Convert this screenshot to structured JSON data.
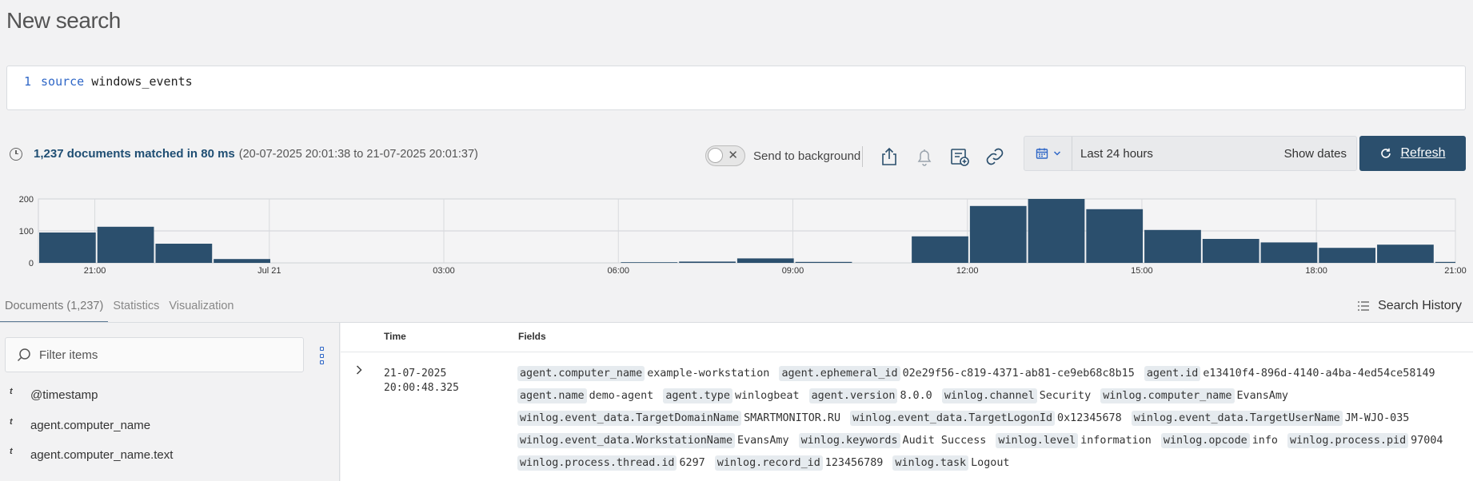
{
  "page": {
    "title": "New search"
  },
  "query": {
    "line_number": "1",
    "keyword": "source",
    "text": "windows_events"
  },
  "summary": {
    "count_text": "1,237 documents matched in 80 ms",
    "range_text": "(20-07-2025 20:01:38 to 21-07-2025 20:01:37)"
  },
  "toolbar": {
    "send_to_background": "Send to background",
    "send_to_background_enabled": false,
    "icons": [
      "share-icon",
      "bell-icon",
      "add-report-icon",
      "link-icon"
    ]
  },
  "date_picker": {
    "preset": "Last 24 hours",
    "show_dates": "Show dates"
  },
  "refresh": {
    "label": "Refresh",
    "accent": "#2b4f6d"
  },
  "chart_data": {
    "type": "bar",
    "y_ticks": [
      "200",
      "100",
      "0"
    ],
    "ylim": [
      0,
      200
    ],
    "x_ticks": [
      "21:00",
      "Jul 21",
      "03:00",
      "06:00",
      "09:00",
      "12:00",
      "15:00",
      "18:00",
      "21:00"
    ],
    "bar_color": "#2b4f6d",
    "grid": true,
    "values": [
      95,
      113,
      60,
      12,
      0,
      0,
      0,
      0,
      0,
      0,
      2,
      4,
      14,
      3,
      0,
      83,
      178,
      200,
      168,
      103,
      75,
      64,
      47,
      57,
      3
    ]
  },
  "tabs": [
    {
      "label": "Documents (1,237)",
      "active": true
    },
    {
      "label": "Statistics",
      "active": false
    },
    {
      "label": "Visualization",
      "active": false
    }
  ],
  "search_history": "Search History",
  "filter": {
    "placeholder": "Filter items"
  },
  "field_list": [
    {
      "type": "t",
      "name": "@timestamp"
    },
    {
      "type": "t",
      "name": "agent.computer_name"
    },
    {
      "type": "t",
      "name": "agent.computer_name.text"
    }
  ],
  "table": {
    "headers": {
      "time": "Time",
      "fields": "Fields"
    },
    "rows": [
      {
        "time": "21-07-2025 20:00:48.325",
        "fields": [
          {
            "k": "agent.computer_name",
            "v": "example-workstation"
          },
          {
            "k": "agent.ephemeral_id",
            "v": "02e29f56-c819-4371-ab81-ce9eb68c8b15"
          },
          {
            "k": "agent.id",
            "v": "e13410f4-896d-4140-a4ba-4ed54ce58149"
          },
          {
            "k": "agent.name",
            "v": "demo-agent"
          },
          {
            "k": "agent.type",
            "v": "winlogbeat"
          },
          {
            "k": "agent.version",
            "v": "8.0.0"
          },
          {
            "k": "winlog.channel",
            "v": "Security"
          },
          {
            "k": "winlog.computer_name",
            "v": "EvansAmy"
          },
          {
            "k": "winlog.event_data.TargetDomainName",
            "v": "SMARTMONITOR.RU"
          },
          {
            "k": "winlog.event_data.TargetLogonId",
            "v": "0x12345678"
          },
          {
            "k": "winlog.event_data.TargetUserName",
            "v": "JM-WJO-035"
          },
          {
            "k": "winlog.event_data.WorkstationName",
            "v": "EvansAmy"
          },
          {
            "k": "winlog.keywords",
            "v": "Audit Success"
          },
          {
            "k": "winlog.level",
            "v": "information"
          },
          {
            "k": "winlog.opcode",
            "v": "info"
          },
          {
            "k": "winlog.process.pid",
            "v": "97004"
          },
          {
            "k": "winlog.process.thread.id",
            "v": "6297"
          },
          {
            "k": "winlog.record_id",
            "v": "123456789"
          },
          {
            "k": "winlog.task",
            "v": "Logout"
          }
        ]
      }
    ]
  }
}
